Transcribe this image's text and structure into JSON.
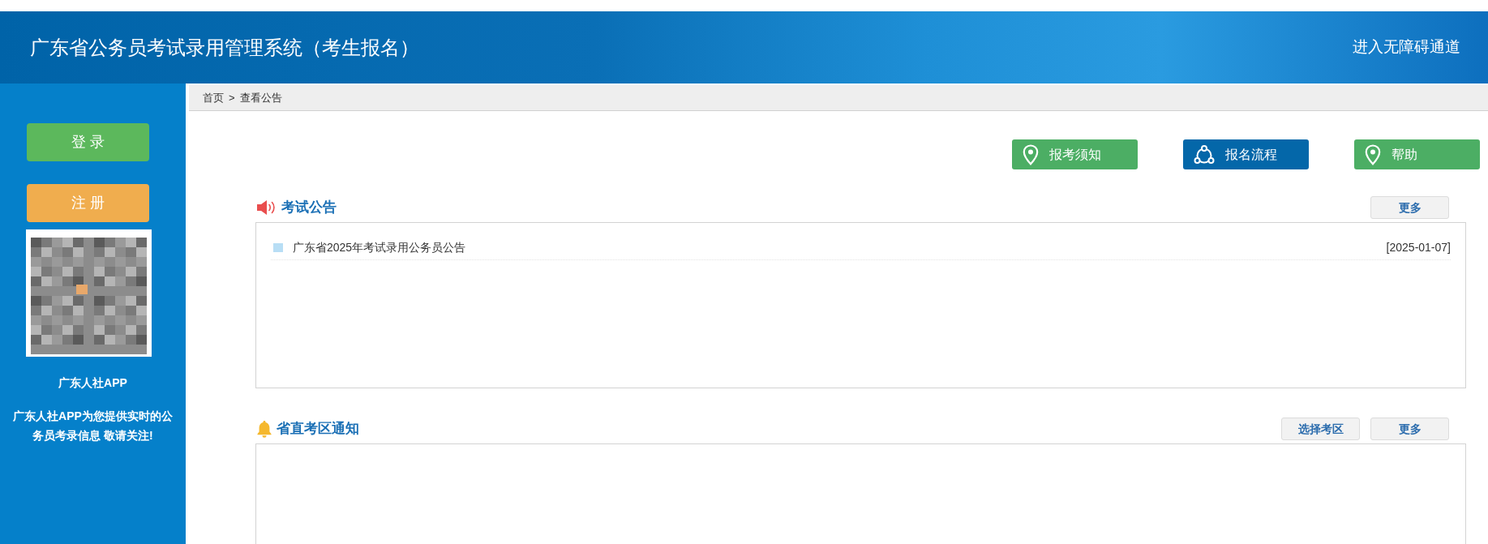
{
  "header": {
    "title": "广东省公务员考试录用管理系统（考生报名）",
    "accessibility_link": "进入无障碍通道"
  },
  "sidebar": {
    "buttons": [
      {
        "label": "登 录",
        "kind": "login"
      },
      {
        "label": "注 册",
        "kind": "register"
      }
    ],
    "app_name": "广东人社APP",
    "app_description": "广东人社APP为您提供实时的公务员考录信息 敬请关注!"
  },
  "breadcrumb": {
    "items": [
      "首页",
      "查看公告"
    ],
    "separator": ">"
  },
  "quick_links": [
    {
      "label": "报考须知",
      "kind": "pin",
      "color": "#4cae64"
    },
    {
      "label": "报名流程",
      "kind": "flow",
      "color": "#0467a9"
    },
    {
      "label": "帮助",
      "kind": "pin",
      "color": "#4cae64"
    }
  ],
  "sections": [
    {
      "title": "考试公告",
      "kind": "announcement",
      "buttons": [
        "更多"
      ],
      "items": [
        {
          "title": "广东省2025年考试录用公务员公告",
          "date": "[2025-01-07]"
        }
      ]
    },
    {
      "title": "省直考区通知",
      "kind": "notice",
      "buttons": [
        "选择考区",
        "更多"
      ]
    }
  ]
}
